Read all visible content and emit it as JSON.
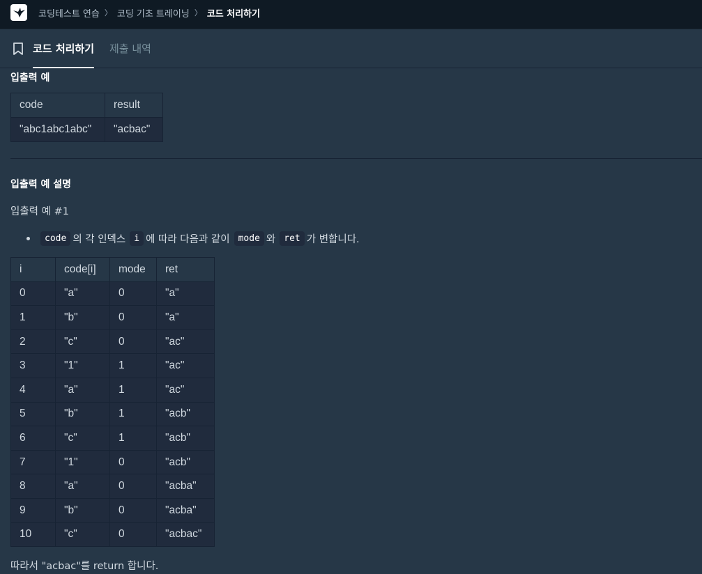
{
  "topbar": {
    "logo_icon": "programmers-logo-icon",
    "breadcrumbs": [
      "코딩테스트 연습",
      "코딩 기초 트레이닝",
      "코드 처리하기"
    ],
    "separator": "〉"
  },
  "tabs": {
    "bookmark_icon": "bookmark-icon",
    "active_label": "코드 처리하기",
    "inactive_label": "제출 내역"
  },
  "example": {
    "heading": "입출력 예",
    "columns": [
      "code",
      "result"
    ],
    "rows": [
      [
        "\"abc1abc1abc\"",
        "\"acbac\""
      ]
    ]
  },
  "explanation": {
    "heading": "입출력 예 설명",
    "subheading": "입출력 예 #1",
    "bullet": {
      "code1": "code",
      "text1": "의 각 인덱스",
      "code2": "i",
      "text2": "에 따라 다음과 같이",
      "code3": "mode",
      "text3": "와",
      "code4": "ret",
      "text4": "가 변합니다."
    },
    "columns": [
      "i",
      "code[i]",
      "mode",
      "ret"
    ],
    "rows": [
      [
        "0",
        "\"a\"",
        "0",
        "\"a\""
      ],
      [
        "1",
        "\"b\"",
        "0",
        "\"a\""
      ],
      [
        "2",
        "\"c\"",
        "0",
        "\"ac\""
      ],
      [
        "3",
        "\"1\"",
        "1",
        "\"ac\""
      ],
      [
        "4",
        "\"a\"",
        "1",
        "\"ac\""
      ],
      [
        "5",
        "\"b\"",
        "1",
        "\"acb\""
      ],
      [
        "6",
        "\"c\"",
        "1",
        "\"acb\""
      ],
      [
        "7",
        "\"1\"",
        "0",
        "\"acb\""
      ],
      [
        "8",
        "\"a\"",
        "0",
        "\"acba\""
      ],
      [
        "9",
        "\"b\"",
        "0",
        "\"acba\""
      ],
      [
        "10",
        "\"c\"",
        "0",
        "\"acbac\""
      ]
    ],
    "conclusion": "따라서 \"acbac\"를 return 합니다."
  }
}
